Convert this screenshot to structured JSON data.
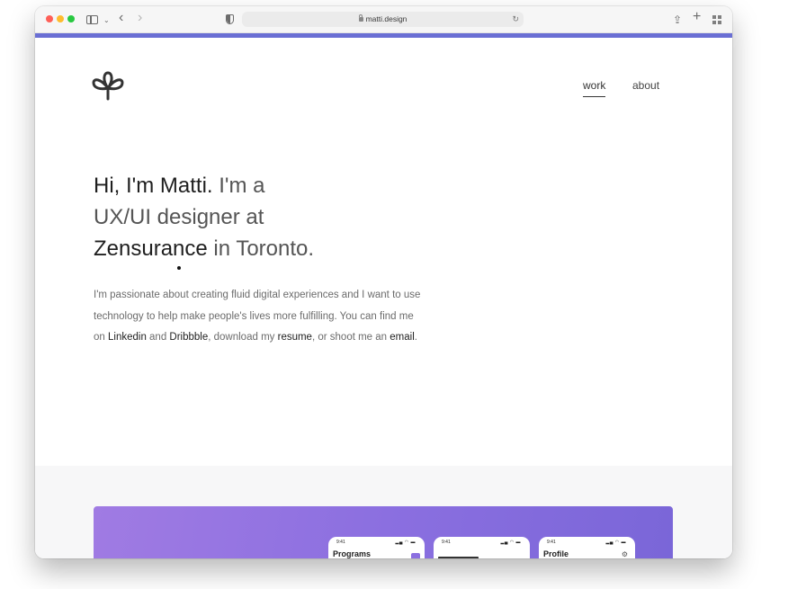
{
  "browser": {
    "url": "matti.design"
  },
  "colors": {
    "accent": "#6a6fd4",
    "project_card": "#8b6fe0"
  },
  "nav": {
    "work": "work",
    "about": "about"
  },
  "hero": {
    "part1": "Hi, I'm Matti.",
    "part2": " I'm a",
    "part3": "UX/UI designer at",
    "part4": "Zensurance",
    "part5": " in Toronto."
  },
  "intro": {
    "text1": "I'm passionate about creating fluid digital experiences and I want to use technology to help make people's lives more fulfilling. You can find me on ",
    "linkedin": "Linkedin",
    "text2": " and ",
    "dribbble": "Dribbble",
    "text3": ", download my ",
    "resume": "resume",
    "text4": ", or shoot me an ",
    "email": "email",
    "text5": "."
  },
  "project": {
    "phones": [
      {
        "time": "9:41",
        "title": "Programs",
        "tag": "",
        "sub": ""
      },
      {
        "time": "9:41",
        "title": "",
        "tag": "",
        "sub": ""
      },
      {
        "time": "9:41",
        "title": "Profile",
        "tag": "",
        "sub": ""
      }
    ]
  },
  "icons": {
    "logo": "leaf-logo-icon",
    "sidebar": "sidebar-icon",
    "back": "chevron-left-icon",
    "forward": "chevron-right-icon",
    "shield": "shield-icon",
    "lock": "lock-icon",
    "reload": "reload-icon",
    "share": "share-icon",
    "new_tab": "plus-icon",
    "tabs": "tab-overview-icon"
  }
}
